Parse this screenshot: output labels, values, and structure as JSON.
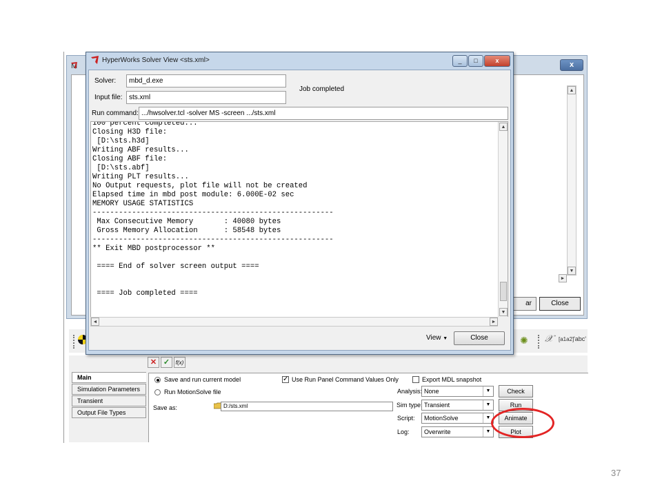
{
  "dialog": {
    "title": "HyperWorks Solver View <sts.xml>",
    "solver_label": "Solver:",
    "solver_value": "mbd_d.exe",
    "input_file_label": "Input file:",
    "input_file_value": "sts.xml",
    "status": "Job completed",
    "run_command_label": "Run command:",
    "run_command_value": ".../hwsolver.tcl -solver MS -screen .../sts.xml",
    "console_text": "100 percent completed...\nClosing H3D file:\n [D:\\sts.h3d]\nWriting ABF results...\nClosing ABF file:\n [D:\\sts.abf]\nWriting PLT results...\nNo Output requests, plot file will not be created\nElapsed time in mbd post module: 6.000E-02 sec\nMEMORY USAGE STATISTICS\n-------------------------------------------------------\n Max Consecutive Memory       : 40080 bytes\n Gross Memory Allocation      : 58548 bytes\n-------------------------------------------------------\n** Exit MBD postprocessor **\n\n ==== End of solver screen output ====\n\n\n ==== Job completed ====",
    "view_label": "View",
    "close_label": "Close",
    "caption_buttons": [
      "_",
      "□",
      "x"
    ]
  },
  "background_window": {
    "title_char": "M",
    "clear_label": "ar",
    "close_label": "Close",
    "close_x": "x"
  },
  "toolbar": {
    "chi_glyph": "𝒳",
    "matrix_label": "[a1a2]",
    "abc_label": "'abc'"
  },
  "run_panel": {
    "fx_buttons": [
      "✕",
      "✓",
      "f(x)"
    ],
    "tabs": [
      {
        "label": "Main",
        "active": true
      },
      {
        "label": "Simulation Parameters",
        "active": false
      },
      {
        "label": "Transient",
        "active": false
      },
      {
        "label": "Output File Types",
        "active": false
      }
    ],
    "radio_save_run": "Save and run current model",
    "radio_run_ms": "Run MotionSolve file",
    "use_run_panel": "Use Run Panel Command Values Only",
    "export_mdl": "Export MDL snapshot",
    "save_as_label": "Save as:",
    "save_as_value": "D:/sts.xml",
    "analysis_label": "Analysis:",
    "analysis_value": "None",
    "simtype_label": "Sim type:",
    "simtype_value": "Transient",
    "script_label": "Script:",
    "script_value": "MotionSolve",
    "log_label": "Log:",
    "log_value": "Overwrite",
    "check_label": "Check",
    "run_label": "Run",
    "animate_label": "Animate",
    "plot_label": "Plot"
  },
  "colors": {
    "highlight": "#e32424",
    "dialog_frame": "#c6d7ea"
  },
  "slide_number": "37"
}
